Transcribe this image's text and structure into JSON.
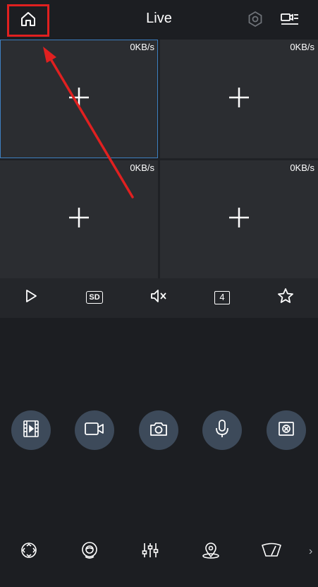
{
  "header": {
    "title": "Live",
    "home_icon": "home-icon",
    "settings_icon": "settings-icon",
    "device_list_icon": "device-list-icon"
  },
  "grid": {
    "cells": [
      {
        "rate": "0KB/s",
        "add_icon": "plus-icon",
        "selected": true
      },
      {
        "rate": "0KB/s",
        "add_icon": "plus-icon",
        "selected": false
      },
      {
        "rate": "0KB/s",
        "add_icon": "plus-icon",
        "selected": false
      },
      {
        "rate": "0KB/s",
        "add_icon": "plus-icon",
        "selected": false
      }
    ]
  },
  "toolbar": {
    "items": [
      "play-icon",
      "sd-quality-icon",
      "mute-icon",
      "split-screen-icon",
      "favorite-icon"
    ],
    "sd_label": "SD",
    "split_label": "4"
  },
  "controls": {
    "items": [
      "playback-icon",
      "record-icon",
      "snapshot-icon",
      "talk-icon",
      "fisheye-icon"
    ]
  },
  "bottom_bar": {
    "items": [
      "ptz-icon",
      "preset-icon",
      "image-adjust-icon",
      "location-icon",
      "wiper-icon"
    ],
    "more": "›"
  },
  "annotation": {
    "color": "#e02020"
  }
}
